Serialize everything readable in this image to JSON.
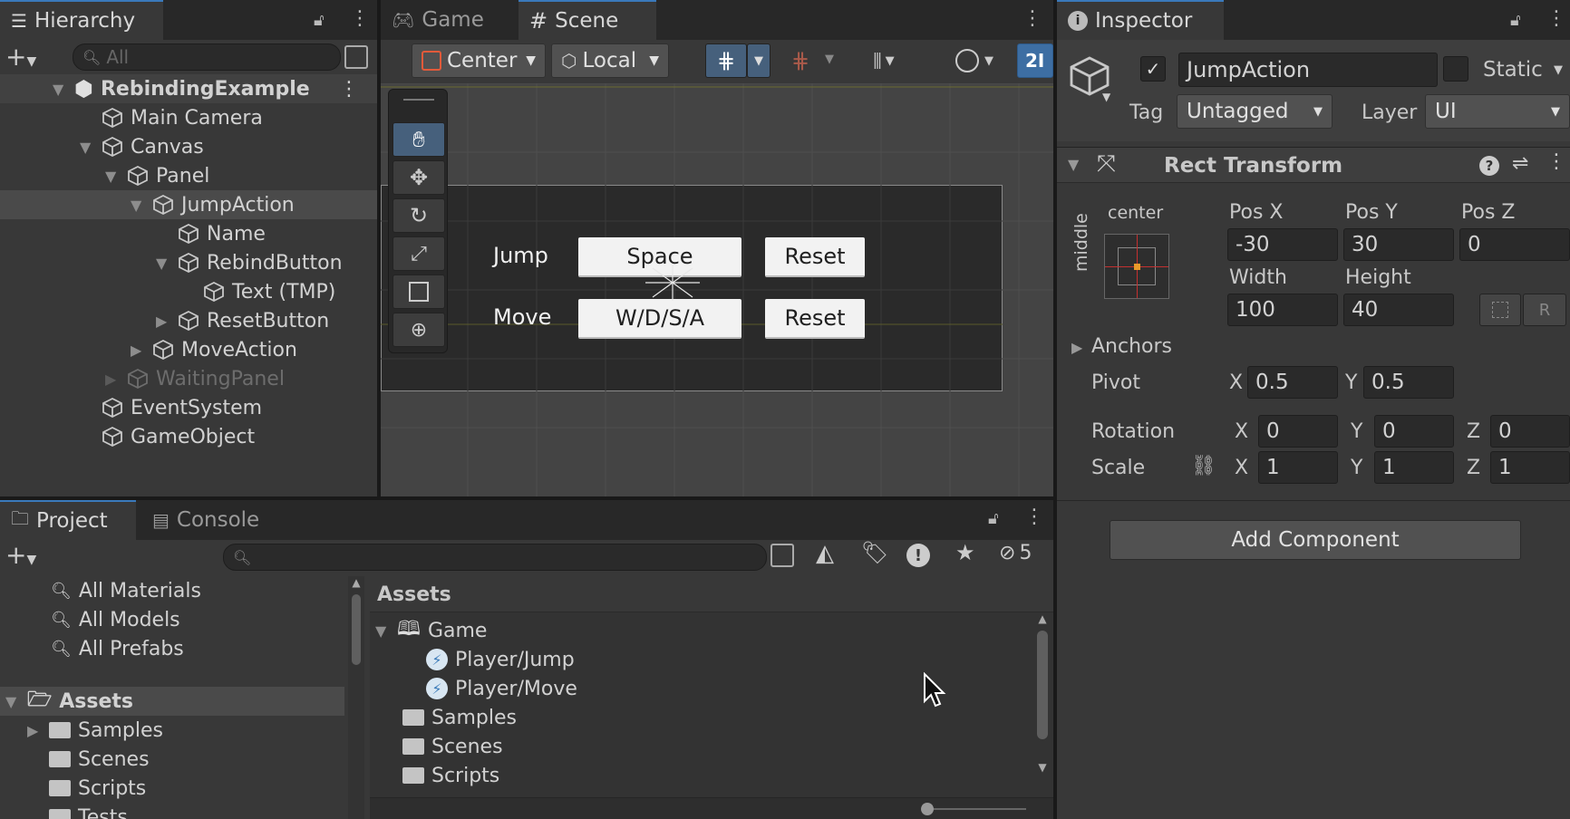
{
  "hierarchy": {
    "tab_label": "Hierarchy",
    "search_placeholder": "All",
    "items": [
      {
        "label": "RebindingExample",
        "icon": "scene-icon",
        "expanded": true
      },
      {
        "label": "Main Camera"
      },
      {
        "label": "Canvas",
        "expanded": true
      },
      {
        "label": "Panel",
        "expanded": true
      },
      {
        "label": "JumpAction",
        "expanded": true,
        "selected": true
      },
      {
        "label": "Name"
      },
      {
        "label": "RebindButton",
        "expanded": true
      },
      {
        "label": "Text (TMP)"
      },
      {
        "label": "ResetButton",
        "expanded": false
      },
      {
        "label": "MoveAction",
        "expanded": false
      },
      {
        "label": "WaitingPanel",
        "expanded": false,
        "inactive": true
      },
      {
        "label": "EventSystem"
      },
      {
        "label": "GameObject"
      }
    ]
  },
  "center": {
    "tabs": [
      {
        "label": "Game",
        "icon": "gamepad-icon"
      },
      {
        "label": "Scene",
        "icon": "hash-icon"
      }
    ],
    "toolbar": {
      "pivot_label": "Center",
      "space_label": "Local",
      "mode_2d": "2I"
    },
    "scene_ui": {
      "jump_label": "Jump",
      "jump_binding": "Space",
      "move_label": "Move",
      "move_binding": "W/D/S/A",
      "reset_label": "Reset"
    }
  },
  "inspector": {
    "tab_label": "Inspector",
    "object_name": "JumpAction",
    "active": true,
    "static_label": "Static",
    "tag_label": "Tag",
    "tag_value": "Untagged",
    "layer_label": "Layer",
    "layer_value": "UI",
    "rect_transform": {
      "title": "Rect Transform",
      "anchor_h": "center",
      "anchor_v": "middle",
      "pos_x_label": "Pos X",
      "pos_x": "-30",
      "pos_y_label": "Pos Y",
      "pos_y": "30",
      "pos_z_label": "Pos Z",
      "pos_z": "0",
      "width_label": "Width",
      "width": "100",
      "height_label": "Height",
      "height": "40",
      "r_label": "R",
      "anchors_label": "Anchors",
      "pivot_label": "Pivot",
      "pivot_x": "0.5",
      "pivot_y": "0.5",
      "rotation_label": "Rotation",
      "rot_x": "0",
      "rot_y": "0",
      "rot_z": "0",
      "scale_label": "Scale",
      "scale_x": "1",
      "scale_y": "1",
      "scale_z": "1",
      "x": "X",
      "y": "Y",
      "z": "Z"
    },
    "add_component_label": "Add Component"
  },
  "project": {
    "tabs": [
      {
        "label": "Project"
      },
      {
        "label": "Console"
      }
    ],
    "hidden_count": "5",
    "favorites": [
      {
        "label": "All Materials"
      },
      {
        "label": "All Models"
      },
      {
        "label": "All Prefabs"
      }
    ],
    "tree_root": "Assets",
    "tree": [
      {
        "label": "Samples"
      },
      {
        "label": "Scenes"
      },
      {
        "label": "Scripts"
      },
      {
        "label": "Tests"
      }
    ],
    "breadcrumb": "Assets",
    "files": [
      {
        "label": "Game",
        "type": "input-actions"
      },
      {
        "label": "Player/Jump",
        "type": "action"
      },
      {
        "label": "Player/Move",
        "type": "action"
      },
      {
        "label": "Samples",
        "type": "folder"
      },
      {
        "label": "Scenes",
        "type": "folder"
      },
      {
        "label": "Scripts",
        "type": "folder"
      }
    ]
  },
  "colors": {
    "accent": "#3a79bb",
    "selection": "#2c5d87",
    "panel": "#383838"
  }
}
